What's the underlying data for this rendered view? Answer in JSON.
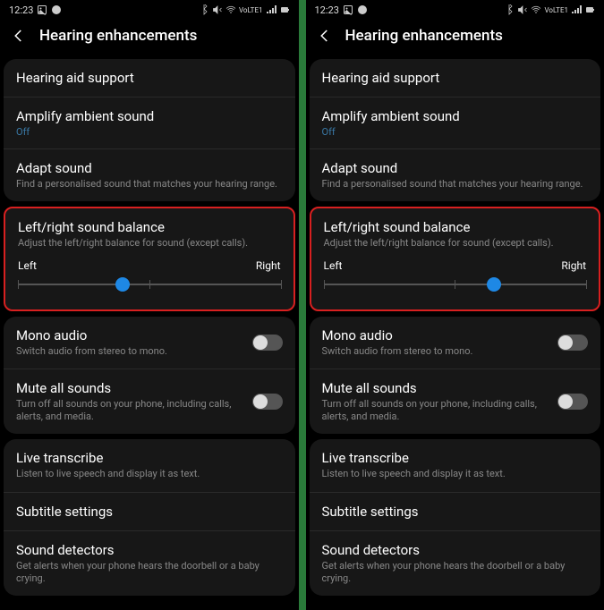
{
  "phones": [
    {
      "balance": 40
    },
    {
      "balance": 65
    }
  ],
  "status": {
    "time": "12:23",
    "network": "VoLTE1",
    "lte": "R"
  },
  "header": {
    "title": "Hearing enhancements"
  },
  "items": {
    "hearing_aid": {
      "title": "Hearing aid support"
    },
    "amplify": {
      "title": "Amplify ambient sound",
      "status": "Off"
    },
    "adapt": {
      "title": "Adapt sound",
      "sub": "Find a personalised sound that matches your hearing range."
    },
    "balance": {
      "title": "Left/right sound balance",
      "sub": "Adjust the left/right balance for sound (except calls).",
      "left": "Left",
      "right": "Right"
    },
    "mono": {
      "title": "Mono audio",
      "sub": "Switch audio from stereo to mono."
    },
    "mute": {
      "title": "Mute all sounds",
      "sub": "Turn off all sounds on your phone, including calls, alerts, and media."
    },
    "transcribe": {
      "title": "Live transcribe",
      "sub": "Listen to live speech and display it as text."
    },
    "subtitle": {
      "title": "Subtitle settings"
    },
    "detectors": {
      "title": "Sound detectors",
      "sub": "Get alerts when your phone hears the doorbell or a baby crying."
    }
  }
}
